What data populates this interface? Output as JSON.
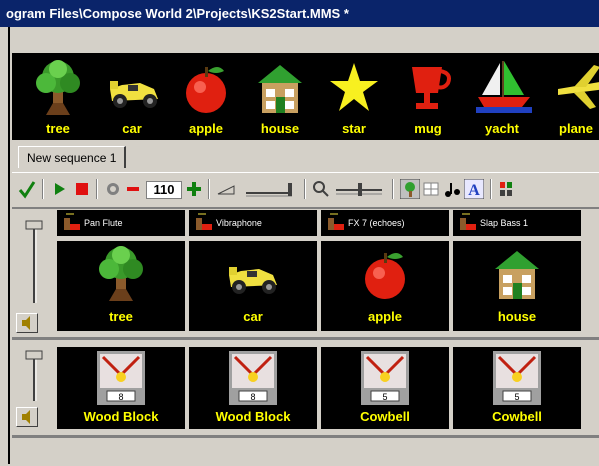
{
  "window": {
    "title": "ogram Files\\Compose World 2\\Projects\\KS2Start.MMS *"
  },
  "palette": {
    "items": [
      {
        "label": "tree",
        "icon": "tree-icon"
      },
      {
        "label": "car",
        "icon": "car-icon"
      },
      {
        "label": "apple",
        "icon": "apple-icon"
      },
      {
        "label": "house",
        "icon": "house-icon"
      },
      {
        "label": "star",
        "icon": "star-icon"
      },
      {
        "label": "mug",
        "icon": "mug-icon"
      },
      {
        "label": "yacht",
        "icon": "yacht-icon"
      },
      {
        "label": "plane",
        "icon": "plane-icon"
      }
    ]
  },
  "tabs": [
    {
      "label": "New sequence 1",
      "active": true
    }
  ],
  "toolbar": {
    "tempo": "110",
    "icons": [
      "check-icon",
      "play-icon",
      "stop-icon",
      "metronome-icon",
      "tempo-decrease-icon",
      "tempo-increase-icon",
      "volume-ramp-icon",
      "volume-slider-icon",
      "zoom-icon",
      "zoom-slider-icon",
      "picture-view-icon",
      "grid-view-icon",
      "notes-view-icon",
      "text-view-icon",
      "instrument-icon"
    ]
  },
  "tracks": [
    {
      "instruments": [
        "Pan Flute",
        "Vibraphone",
        "FX 7 (echoes)",
        "Slap Bass 1"
      ],
      "cells": [
        {
          "label": "tree",
          "icon": "tree-icon"
        },
        {
          "label": "car",
          "icon": "car-icon"
        },
        {
          "label": "apple",
          "icon": "apple-icon"
        },
        {
          "label": "house",
          "icon": "house-icon"
        }
      ]
    },
    {
      "cells": [
        {
          "label": "Wood Block",
          "number": "8",
          "icon": "drum-pad-icon"
        },
        {
          "label": "Wood Block",
          "number": "8",
          "icon": "drum-pad-icon"
        },
        {
          "label": "Cowbell",
          "number": "5",
          "icon": "drum-pad-icon"
        },
        {
          "label": "Cowbell",
          "number": "5",
          "icon": "drum-pad-icon"
        }
      ]
    }
  ],
  "colors": {
    "titlebar": "#0a246a",
    "label_yellow": "#ffff00",
    "cell_background": "#000000"
  }
}
